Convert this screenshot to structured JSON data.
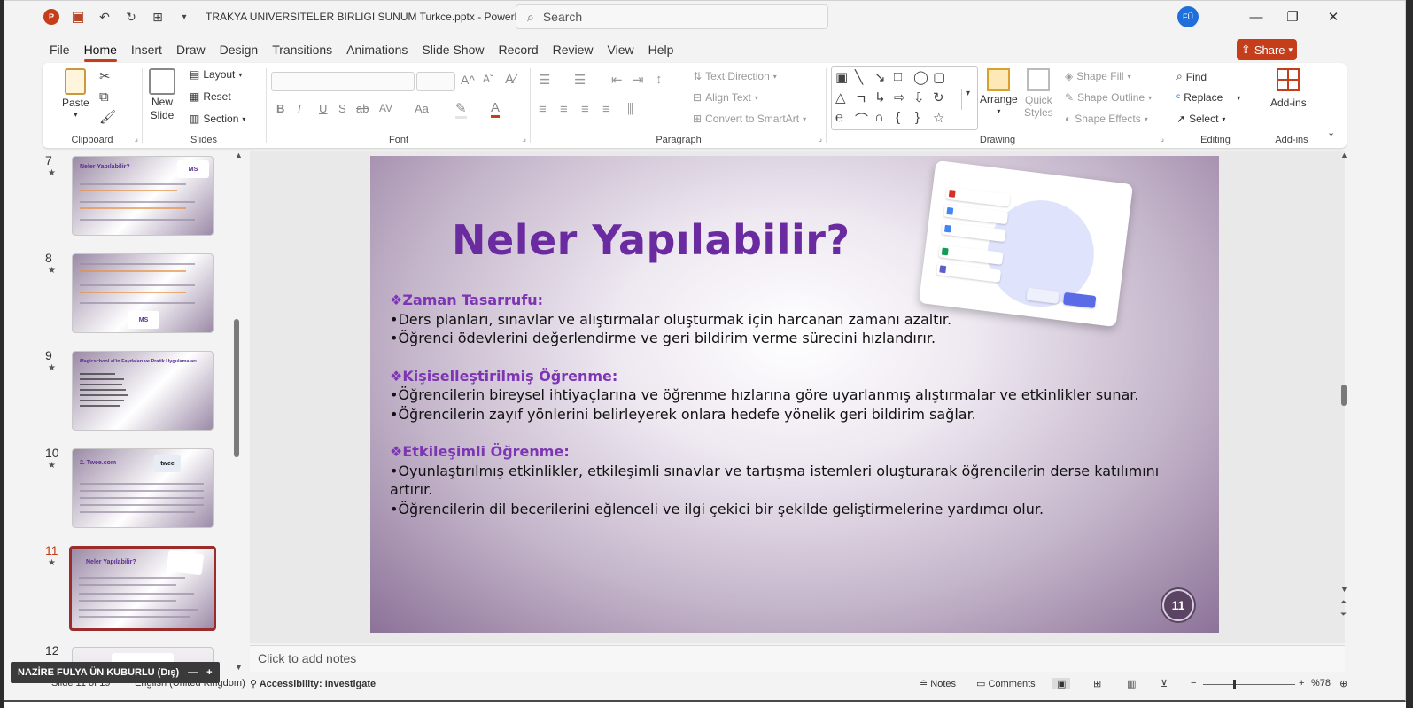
{
  "window": {
    "file_title": "TRAKYA UNIVERSITELER BIRLIGI SUNUM Turkce.pptx",
    "app_name": "PowerPoint",
    "separator": "-",
    "search_placeholder": "Search",
    "user_initials": "FÜ"
  },
  "menu": [
    "File",
    "Home",
    "Insert",
    "Draw",
    "Design",
    "Transitions",
    "Animations",
    "Slide Show",
    "Record",
    "Review",
    "View",
    "Help"
  ],
  "share_label": "Share",
  "ribbon": {
    "clipboard": {
      "paste": "Paste",
      "label": "Clipboard"
    },
    "slides": {
      "new_slide_1": "New",
      "new_slide_2": "Slide",
      "layout": "Layout",
      "reset": "Reset",
      "section": "Section",
      "label": "Slides"
    },
    "font": {
      "label": "Font",
      "bold": "B",
      "italic": "I",
      "underline": "U",
      "strike": "S",
      "strike2": "ab",
      "spacing": "AV",
      "case": "Aa",
      "grow": "A",
      "shrink": "A"
    },
    "paragraph": {
      "label": "Paragraph",
      "text_direction": "Text Direction",
      "align_text": "Align Text",
      "smartart": "Convert to SmartArt"
    },
    "drawing": {
      "arrange": "Arrange",
      "quick_styles_1": "Quick",
      "quick_styles_2": "Styles",
      "shape_fill": "Shape Fill",
      "shape_outline": "Shape Outline",
      "shape_effects": "Shape Effects",
      "label": "Drawing"
    },
    "editing": {
      "find": "Find",
      "replace": "Replace",
      "select": "Select",
      "label": "Editing"
    },
    "addins": {
      "addins": "Add-ins",
      "label": "Add-ins"
    }
  },
  "thumbnails": [
    {
      "num": "7",
      "title": "Neler Yapılabilir?"
    },
    {
      "num": "8",
      "title": ""
    },
    {
      "num": "9",
      "title": "Magicschool.ai'in Faydaları ve Pratik Uygulamaları"
    },
    {
      "num": "10",
      "title": "2. Twee.com"
    },
    {
      "num": "11",
      "title": "Neler Yapılabilir?"
    },
    {
      "num": "12",
      "title": ""
    }
  ],
  "slide": {
    "title": "Neler Yapılabilir?",
    "sections": [
      {
        "heading": "❖Zaman Tasarrufu:",
        "lines": [
          "•Ders planları, sınavlar ve alıştırmalar oluşturmak için harcanan zamanı azaltır.",
          "•Öğrenci ödevlerini değerlendirme ve geri bildirim verme sürecini hızlandırır."
        ]
      },
      {
        "heading": "❖Kişiselleştirilmiş Öğrenme:",
        "lines": [
          "•Öğrencilerin bireysel ihtiyaçlarına ve öğrenme hızlarına göre uyarlanmış alıştırmalar ve etkinlikler sunar.",
          "•Öğrencilerin zayıf yönlerini belirleyerek onlara hedefe yönelik geri bildirim sağlar."
        ]
      },
      {
        "heading": "❖Etkileşimli Öğrenme:",
        "lines": [
          "•Oyunlaştırılmış etkinlikler, etkileşimli sınavlar ve tartışma istemleri oluşturarak öğrencilerin derse katılımını artırır.",
          "•Öğrencilerin dil becerilerini eğlenceli ve ilgi çekici bir şekilde geliştirmelerine yardımcı olur."
        ]
      }
    ],
    "page_number": "11"
  },
  "notes_placeholder": "Click to add notes",
  "status": {
    "slide_info": "Slide 11 of 19",
    "language": "English (United Kingdom)",
    "accessibility": "Accessibility: Investigate",
    "notes": "Notes",
    "comments": "Comments",
    "zoom": "%78"
  },
  "user_tag": "NAZİRE FULYA ÜN KUBURLU (Dış)",
  "colors": {
    "accent": "#c43e1c",
    "title_purple": "#6a2aa0",
    "heading_purple": "#7d35b4"
  }
}
